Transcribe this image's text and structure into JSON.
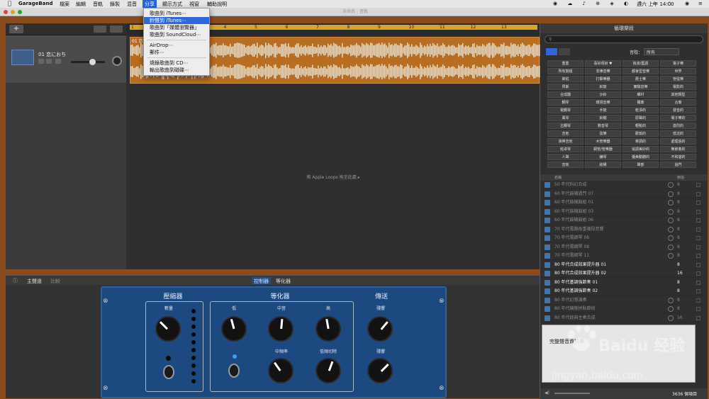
{
  "menubar": {
    "app": "GarageBand",
    "items": [
      "檔案",
      "編輯",
      "音軌",
      "錄製",
      "混音",
      "分享",
      "顯示方式",
      "視窗",
      "輔助說明"
    ],
    "active": "分享",
    "clock": "週六 上午 14:00"
  },
  "window": {
    "title": "未命名 - 音軌"
  },
  "share_menu": {
    "items": [
      "歌曲到 iTunes⋯",
      "鈴聲到 iTunes⋯",
      "歌曲到「媒體瀏覽器」",
      "歌曲到 SoundCloud⋯",
      "AirDrop⋯",
      "郵件⋯",
      "燒錄歌曲到 CD⋯",
      "輸出歌曲到磁碟⋯"
    ],
    "highlighted": "鈴聲到 iTunes⋯"
  },
  "ruler": {
    "marks": [
      "1",
      "2",
      "3",
      "4",
      "5",
      "6",
      "7",
      "8",
      "9",
      "10",
      "11",
      "12",
      "13"
    ]
  },
  "track": {
    "name": "01 恋におち",
    "region_label": "01 恋"
  },
  "drop_message": "將 Apple Loops 拖至此處 ▸",
  "editor": {
    "tabs_left": [
      "主聲道",
      "比較"
    ],
    "tabs_center": [
      "控制器",
      "等化器"
    ],
    "sections": {
      "compressor": "壓縮器",
      "eq": "等化器",
      "send": "傳送"
    },
    "knobs": {
      "amount": "數量",
      "low": "低",
      "mid": "中音",
      "high": "高",
      "mid_freq": "中頻率",
      "low_cut": "低頻切除",
      "reverb": "殘響",
      "echo": "殘響"
    }
  },
  "loops": {
    "title": "循環樂段",
    "instrument_label": "音階：",
    "instrument_value": "所有",
    "keywords": [
      [
        "重置",
        "喜好項目 ♥",
        "搖滾/藍調",
        "電子樂"
      ],
      [
        "所有鼓組",
        "非律音樂",
        "都會型音樂",
        "世界"
      ],
      [
        "節拍",
        "打擊樂器",
        "爵士樂",
        "管弦樂"
      ],
      [
        "貝斯",
        "鈴鼓",
        "實驗音樂",
        "電影的"
      ],
      [
        "合成器",
        "沙鈴",
        "鄉村",
        "其他類型"
      ],
      [
        "鋼琴",
        "環境音樂",
        "獨奏",
        "合奏"
      ],
      [
        "電鋼琴",
        "手鼓",
        "乾淨的",
        "發音的"
      ],
      [
        "風琴",
        "鈴鐺",
        "原聲的",
        "電子樂的"
      ],
      [
        "古鋼琴",
        "數音琴",
        "輕鬆的",
        "激烈的"
      ],
      [
        "吉他",
        "弦樂",
        "歡愉的",
        "低沈的"
      ],
      [
        "滑棒吉他",
        "木管樂器",
        "單調的",
        "處理過的"
      ],
      [
        "班卓琴",
        "銅管/管樂器",
        "協調美妙的",
        "無節奏的"
      ],
      [
        "人聲",
        "鐘琴",
        "優美動聽的",
        "不和諧的"
      ],
      [
        "音效",
        "結構",
        "聲部",
        "過門"
      ]
    ],
    "columns": {
      "name": "名稱",
      "beats": "節拍"
    },
    "rows": [
      {
        "name": "50 年代科幻合成",
        "beats": "8",
        "dim": true
      },
      {
        "name": "60 年代鼓機過門 07",
        "beats": "8",
        "dim": true
      },
      {
        "name": "60 年代鼓機鼓組 01",
        "beats": "8",
        "dim": true
      },
      {
        "name": "60 年代鼓機鼓組 03",
        "beats": "8",
        "dim": true
      },
      {
        "name": "60 年代鼓機鼓組 06",
        "beats": "8",
        "dim": true
      },
      {
        "name": "70 年代電路板重複段音響",
        "beats": "8",
        "dim": true
      },
      {
        "name": "70 年代電鋼琴 06",
        "beats": "8",
        "dim": true
      },
      {
        "name": "70 年代電鋼琴 08",
        "beats": "8",
        "dim": true
      },
      {
        "name": "70 年代電鋼琴 11",
        "beats": "8",
        "dim": true
      },
      {
        "name": "80 年代合成效果提升器 01",
        "beats": "8",
        "dim": false
      },
      {
        "name": "80 年代合成效果提升器 02",
        "beats": "16",
        "dim": false
      },
      {
        "name": "80 年代基調強節奏 01",
        "beats": "8",
        "dim": false
      },
      {
        "name": "80 年代基調強節奏 02",
        "beats": "8",
        "dim": false
      },
      {
        "name": "80 年代幻想演奏",
        "beats": "8",
        "dim": true
      },
      {
        "name": "80 年代機態拼貼節拍",
        "beats": "8",
        "dim": true
      },
      {
        "name": "80 年代經典主奏合成",
        "beats": "16",
        "dim": true
      }
    ],
    "popup_title": "完整聲音資料庫",
    "count": "3636 個項目"
  },
  "watermark": {
    "brand": "Baidu 经验",
    "url": "jingyan.baidu.com"
  },
  "colors": {
    "region": "#b86d21",
    "cycle": "#d8a52c",
    "panel": "#1c4a80",
    "highlight": "#2b6ad8"
  }
}
